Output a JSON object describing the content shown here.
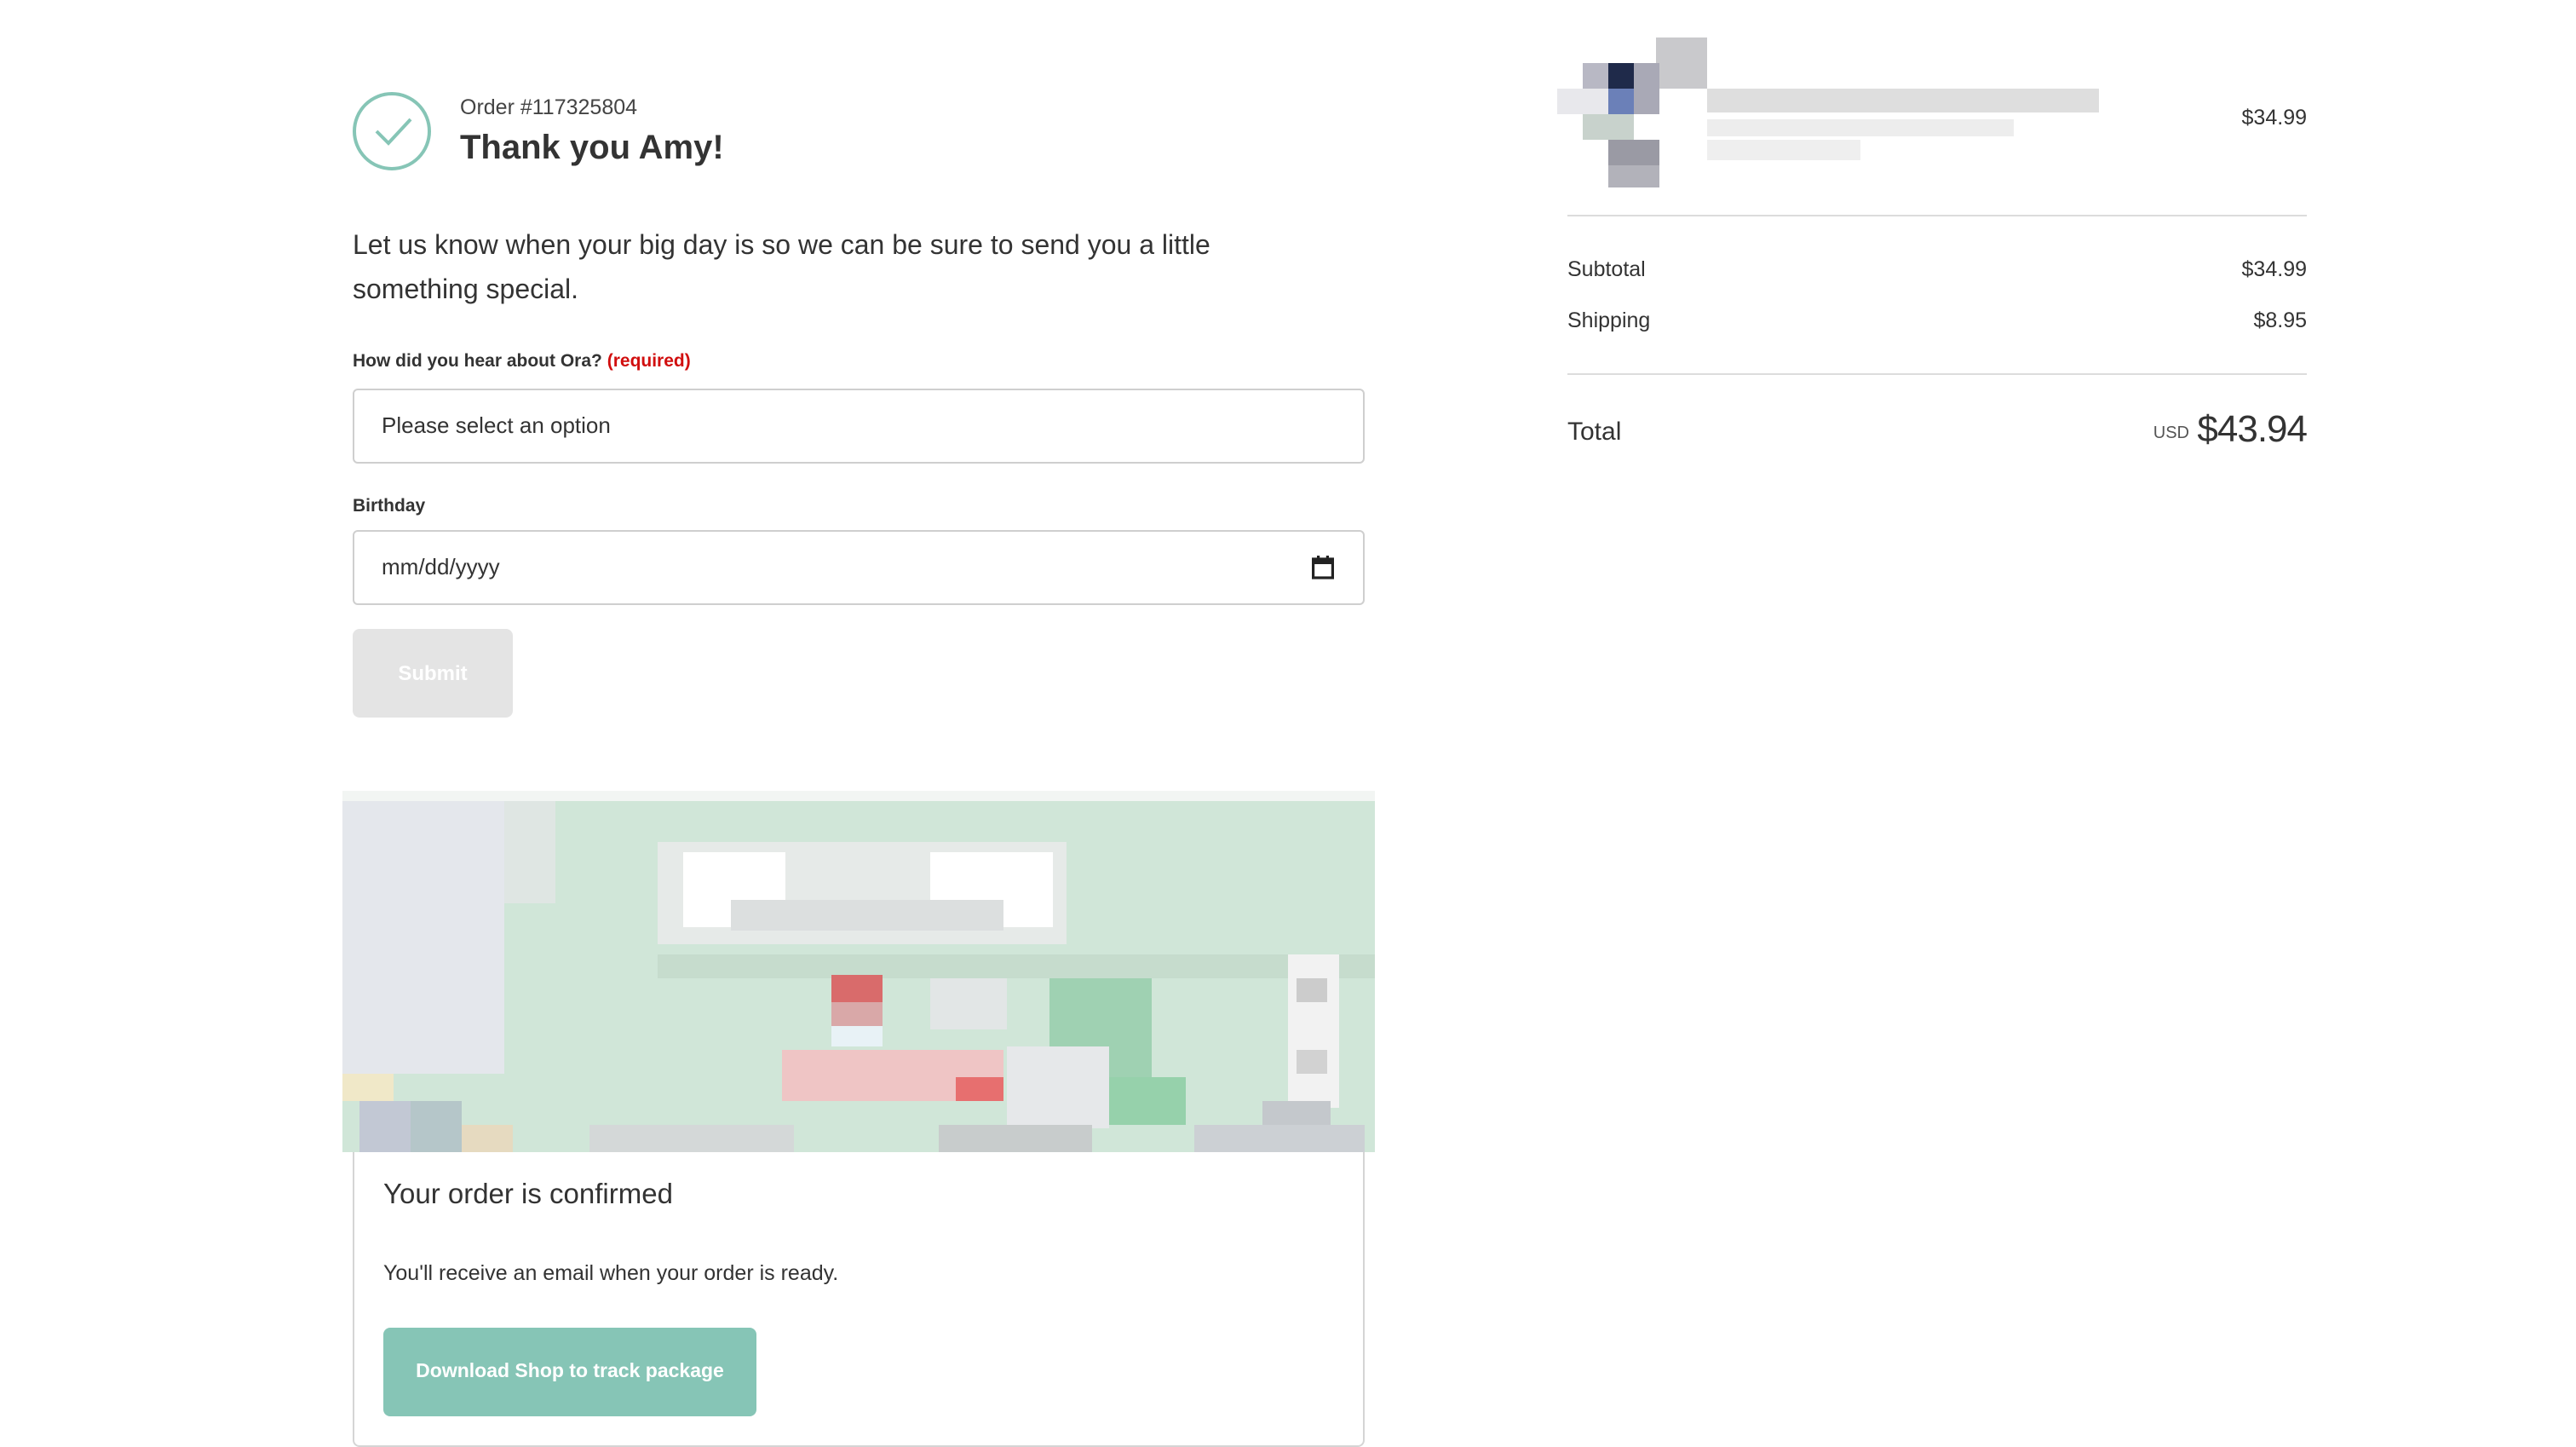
{
  "header": {
    "order_number": "Order #117325804",
    "thank_you": "Thank you Amy!"
  },
  "intro_text": "Let us know when your big day is so we can be sure to send you a little something special.",
  "form": {
    "hear_about_label": "How did you hear about Ora?",
    "required_label": "(required)",
    "hear_about_value": "Please select an option",
    "birthday_label": "Birthday",
    "birthday_placeholder": "mm/dd/yyyy",
    "submit_label": "Submit"
  },
  "confirmation": {
    "title": "Your order is confirmed",
    "message": "You'll receive an email when your order is ready.",
    "shop_button_label": "Download Shop to track package"
  },
  "summary": {
    "product_price": "$34.99",
    "subtotal_label": "Subtotal",
    "subtotal_value": "$34.99",
    "shipping_label": "Shipping",
    "shipping_value": "$8.95",
    "total_label": "Total",
    "currency": "USD",
    "total_value": "$43.94"
  },
  "colors": {
    "accent": "#86c5b6",
    "required": "#d10e0e",
    "disabled_button": "#e4e4e4"
  },
  "icons": {
    "status": "checkmark-circle-icon",
    "date_field": "calendar-icon"
  }
}
